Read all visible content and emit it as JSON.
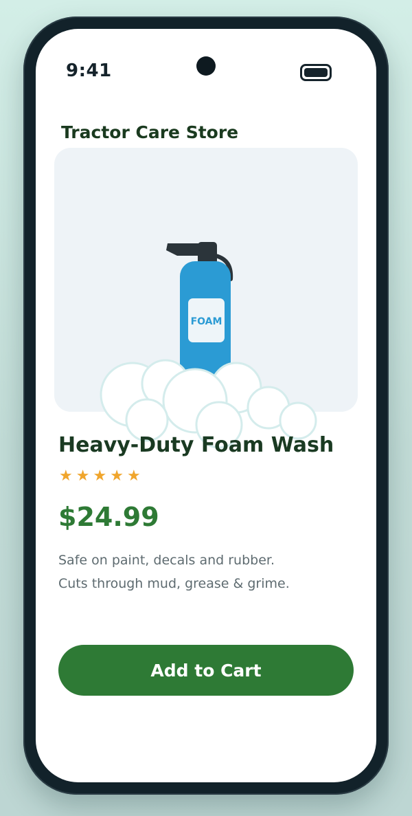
{
  "status_bar": {
    "time": "9:41",
    "battery_icon": "battery-full-icon",
    "camera_icon": "front-camera-icon"
  },
  "store": {
    "title": "Tractor Care Store"
  },
  "product": {
    "image_label": "FOAM",
    "image_icon": "foam-bottle-illustration",
    "name": "Heavy-Duty Foam Wash",
    "rating": {
      "stars": 5,
      "max": 5,
      "star_glyph": "★",
      "color": "#f0a52c"
    },
    "price": "$24.99",
    "description_lines": [
      "Safe on paint, decals and rubber.",
      "Cuts through mud, grease & grime."
    ]
  },
  "actions": {
    "add_to_cart_label": "Add to Cart"
  },
  "colors": {
    "accent": "#2e7a35",
    "title": "#1a3a22",
    "bottle": "#2b9bd4",
    "card_background": "#eef3f7"
  }
}
